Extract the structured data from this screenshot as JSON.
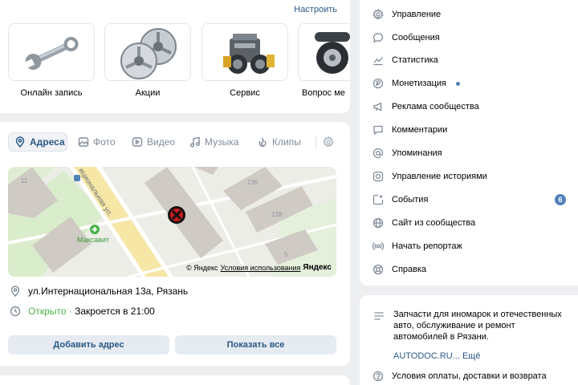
{
  "services": {
    "settings_label": "Настроить",
    "items": [
      {
        "label": "Онлайн запись",
        "icon": "wrench-icon"
      },
      {
        "label": "Акции",
        "icon": "wheel-rims-icon"
      },
      {
        "label": "Сервис",
        "icon": "engine-icon"
      },
      {
        "label": "Вопрос ме",
        "icon": "tire-icon"
      }
    ]
  },
  "tabs": [
    {
      "label": "Адреса",
      "icon": "location-pin-icon"
    },
    {
      "label": "Фото",
      "icon": "photo-icon"
    },
    {
      "label": "Видео",
      "icon": "video-icon"
    },
    {
      "label": "Музыка",
      "icon": "music-icon"
    },
    {
      "label": "Клипы",
      "icon": "clips-icon"
    }
  ],
  "map": {
    "street_label": "ициональная ул.",
    "poi_label": "Максавит",
    "house_numbers": [
      "11",
      "136",
      "138",
      "5"
    ],
    "attribution_copyright": "© Яндекс",
    "attribution_link": "Условия использования",
    "attribution_brand": "Яндекс"
  },
  "address": {
    "text": "ул.Интернациональная 13а, Рязань",
    "status_open": "Открыто",
    "status_sep": " · ",
    "status_close": "Закроется в 21:00",
    "accent_open": "#4bb34b"
  },
  "buttons": {
    "add_address": "Добавить адрес",
    "show_all": "Показать все"
  },
  "menu": {
    "items": [
      {
        "label": "Управление",
        "icon": "gear-icon"
      },
      {
        "label": "Сообщения",
        "icon": "message-icon"
      },
      {
        "label": "Статистика",
        "icon": "stats-icon"
      },
      {
        "label": "Монетизация",
        "icon": "ruble-icon",
        "dot": true
      },
      {
        "label": "Реклама сообщества",
        "icon": "megaphone-icon"
      },
      {
        "label": "Комментарии",
        "icon": "comment-icon"
      },
      {
        "label": "Упоминания",
        "icon": "at-icon"
      },
      {
        "label": "Управление историями",
        "icon": "stories-icon"
      },
      {
        "label": "События",
        "icon": "events-icon",
        "badge": "6"
      },
      {
        "label": "Сайт из сообщества",
        "icon": "globe-icon"
      },
      {
        "label": "Начать репортаж",
        "icon": "live-icon"
      },
      {
        "label": "Справка",
        "icon": "help-icon"
      }
    ]
  },
  "info": {
    "description": "Запчасти для иномарок и отечественных авто, обслуживание и ремонт автомобилей в Рязани.",
    "link": "AUTODOC.RU",
    "more": "... Ещё",
    "terms": "Условия оплаты, доставки и возврата"
  },
  "colors": {
    "background": "#edeef0",
    "link": "#2a5885",
    "icon_gray": "#818c99",
    "badge": "#5181b8"
  }
}
